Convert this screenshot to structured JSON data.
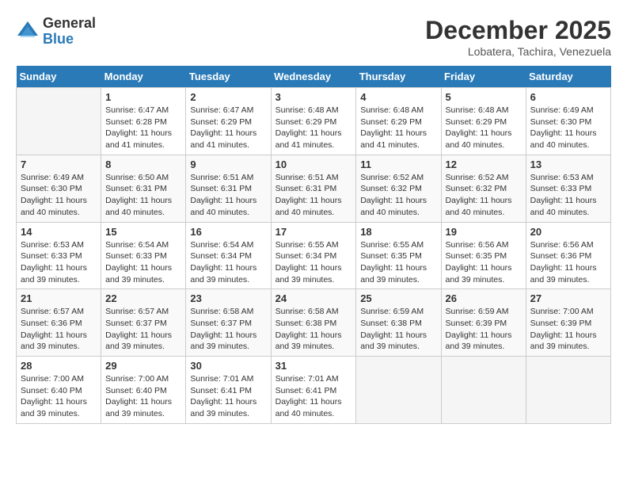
{
  "header": {
    "logo_line1": "General",
    "logo_line2": "Blue",
    "month_title": "December 2025",
    "location": "Lobatera, Tachira, Venezuela"
  },
  "days_of_week": [
    "Sunday",
    "Monday",
    "Tuesday",
    "Wednesday",
    "Thursday",
    "Friday",
    "Saturday"
  ],
  "weeks": [
    [
      {
        "day": "",
        "info": ""
      },
      {
        "day": "1",
        "info": "Sunrise: 6:47 AM\nSunset: 6:28 PM\nDaylight: 11 hours\nand 41 minutes."
      },
      {
        "day": "2",
        "info": "Sunrise: 6:47 AM\nSunset: 6:29 PM\nDaylight: 11 hours\nand 41 minutes."
      },
      {
        "day": "3",
        "info": "Sunrise: 6:48 AM\nSunset: 6:29 PM\nDaylight: 11 hours\nand 41 minutes."
      },
      {
        "day": "4",
        "info": "Sunrise: 6:48 AM\nSunset: 6:29 PM\nDaylight: 11 hours\nand 41 minutes."
      },
      {
        "day": "5",
        "info": "Sunrise: 6:48 AM\nSunset: 6:29 PM\nDaylight: 11 hours\nand 40 minutes."
      },
      {
        "day": "6",
        "info": "Sunrise: 6:49 AM\nSunset: 6:30 PM\nDaylight: 11 hours\nand 40 minutes."
      }
    ],
    [
      {
        "day": "7",
        "info": "Sunrise: 6:49 AM\nSunset: 6:30 PM\nDaylight: 11 hours\nand 40 minutes."
      },
      {
        "day": "8",
        "info": "Sunrise: 6:50 AM\nSunset: 6:31 PM\nDaylight: 11 hours\nand 40 minutes."
      },
      {
        "day": "9",
        "info": "Sunrise: 6:51 AM\nSunset: 6:31 PM\nDaylight: 11 hours\nand 40 minutes."
      },
      {
        "day": "10",
        "info": "Sunrise: 6:51 AM\nSunset: 6:31 PM\nDaylight: 11 hours\nand 40 minutes."
      },
      {
        "day": "11",
        "info": "Sunrise: 6:52 AM\nSunset: 6:32 PM\nDaylight: 11 hours\nand 40 minutes."
      },
      {
        "day": "12",
        "info": "Sunrise: 6:52 AM\nSunset: 6:32 PM\nDaylight: 11 hours\nand 40 minutes."
      },
      {
        "day": "13",
        "info": "Sunrise: 6:53 AM\nSunset: 6:33 PM\nDaylight: 11 hours\nand 40 minutes."
      }
    ],
    [
      {
        "day": "14",
        "info": "Sunrise: 6:53 AM\nSunset: 6:33 PM\nDaylight: 11 hours\nand 39 minutes."
      },
      {
        "day": "15",
        "info": "Sunrise: 6:54 AM\nSunset: 6:33 PM\nDaylight: 11 hours\nand 39 minutes."
      },
      {
        "day": "16",
        "info": "Sunrise: 6:54 AM\nSunset: 6:34 PM\nDaylight: 11 hours\nand 39 minutes."
      },
      {
        "day": "17",
        "info": "Sunrise: 6:55 AM\nSunset: 6:34 PM\nDaylight: 11 hours\nand 39 minutes."
      },
      {
        "day": "18",
        "info": "Sunrise: 6:55 AM\nSunset: 6:35 PM\nDaylight: 11 hours\nand 39 minutes."
      },
      {
        "day": "19",
        "info": "Sunrise: 6:56 AM\nSunset: 6:35 PM\nDaylight: 11 hours\nand 39 minutes."
      },
      {
        "day": "20",
        "info": "Sunrise: 6:56 AM\nSunset: 6:36 PM\nDaylight: 11 hours\nand 39 minutes."
      }
    ],
    [
      {
        "day": "21",
        "info": "Sunrise: 6:57 AM\nSunset: 6:36 PM\nDaylight: 11 hours\nand 39 minutes."
      },
      {
        "day": "22",
        "info": "Sunrise: 6:57 AM\nSunset: 6:37 PM\nDaylight: 11 hours\nand 39 minutes."
      },
      {
        "day": "23",
        "info": "Sunrise: 6:58 AM\nSunset: 6:37 PM\nDaylight: 11 hours\nand 39 minutes."
      },
      {
        "day": "24",
        "info": "Sunrise: 6:58 AM\nSunset: 6:38 PM\nDaylight: 11 hours\nand 39 minutes."
      },
      {
        "day": "25",
        "info": "Sunrise: 6:59 AM\nSunset: 6:38 PM\nDaylight: 11 hours\nand 39 minutes."
      },
      {
        "day": "26",
        "info": "Sunrise: 6:59 AM\nSunset: 6:39 PM\nDaylight: 11 hours\nand 39 minutes."
      },
      {
        "day": "27",
        "info": "Sunrise: 7:00 AM\nSunset: 6:39 PM\nDaylight: 11 hours\nand 39 minutes."
      }
    ],
    [
      {
        "day": "28",
        "info": "Sunrise: 7:00 AM\nSunset: 6:40 PM\nDaylight: 11 hours\nand 39 minutes."
      },
      {
        "day": "29",
        "info": "Sunrise: 7:00 AM\nSunset: 6:40 PM\nDaylight: 11 hours\nand 39 minutes."
      },
      {
        "day": "30",
        "info": "Sunrise: 7:01 AM\nSunset: 6:41 PM\nDaylight: 11 hours\nand 39 minutes."
      },
      {
        "day": "31",
        "info": "Sunrise: 7:01 AM\nSunset: 6:41 PM\nDaylight: 11 hours\nand 40 minutes."
      },
      {
        "day": "",
        "info": ""
      },
      {
        "day": "",
        "info": ""
      },
      {
        "day": "",
        "info": ""
      }
    ]
  ]
}
